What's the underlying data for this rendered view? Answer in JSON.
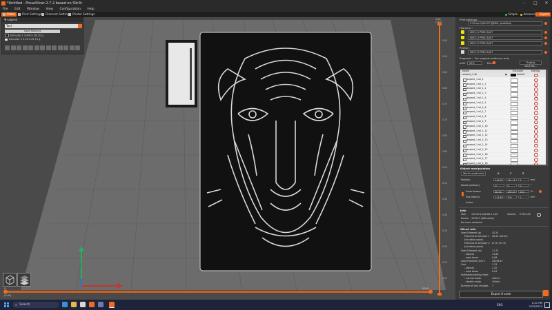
{
  "window": {
    "title": "*Untitled - PrusaSlicer-2.7.2 based on Slic3r",
    "controls": [
      "–",
      "□",
      "✕"
    ]
  },
  "menu": [
    "File",
    "Edit",
    "Window",
    "View",
    "Configuration",
    "Help"
  ],
  "tabs": [
    {
      "label": "Plater",
      "active": true
    },
    {
      "label": "Print Settings",
      "active": false
    },
    {
      "label": "Filament Settings",
      "active": false
    },
    {
      "label": "Printer Settings",
      "active": false
    }
  ],
  "modes": [
    {
      "label": "Simple",
      "color": "#2ecc40"
    },
    {
      "label": "Advanced",
      "color": "#f1c40f"
    },
    {
      "label": "Expert",
      "color": "#e74c3c"
    }
  ],
  "legend": {
    "title": "Legend",
    "view_type": "Tool",
    "section": "Used filament",
    "extruders": [
      {
        "label": "Extruder 1  9.49 m   28.52 g",
        "color": "#111111"
      },
      {
        "label": "Extruder 2  2.24 m   6.73 g",
        "color": "#e8e8e8"
      }
    ]
  },
  "view_cube_icons": [
    "cube-view-icon",
    "layers-view-icon"
  ],
  "slider": {
    "top_values": [
      "1.00",
      "(115)"
    ],
    "ticks": [
      "0.95",
      "0.90",
      "0.85",
      "0.80",
      "0.75",
      "0.70",
      "0.65",
      "0.60",
      "0.55",
      "0.50",
      "0.45",
      "0.40",
      "0.35",
      "0.30",
      "0.25",
      "0.20"
    ],
    "bottom_left": "0",
    "bottom_left2": "(0.00)",
    "bottom_right": "6188"
  },
  "sidebar": {
    "print_settings_label": "Print settings :",
    "print_profile": "0.20mm QUALITY @MK4 (modified)",
    "filament_label": "Filament :",
    "filaments": [
      {
        "name": "SKR 1.2 PREC A/UIT",
        "color": "#f2e600"
      },
      {
        "name": "SKR 1.2 PREC A/UIT",
        "color": "#f2e600"
      },
      {
        "name": "SKR 1.2 PREC A/UIT",
        "color": "#f2e600"
      }
    ],
    "printer_label": "Printer :",
    "printer": "SKR 1.2 PREC A/UIT",
    "supports_label": "Supports :",
    "supports_value": "For support enforcers only",
    "infill_label": "Infill :",
    "infill_value": "20%",
    "brim_label": "Brim :",
    "purging_button": "Purging volumes...",
    "list_headers": {
      "name": "Name",
      "extruder": "Extruder",
      "editing": "Editing"
    },
    "objects": [
      {
        "name": "Leopard_1.stl",
        "extruder": "default"
      },
      {
        "name": "Leopard_1.stl_1",
        "extruder": "1"
      },
      {
        "name": "Leopard_1.stl_1_1",
        "extruder": "1"
      },
      {
        "name": "Leopard_1.stl_1_2",
        "extruder": "1"
      },
      {
        "name": "Leopard_1.stl_1_3",
        "extruder": "1"
      },
      {
        "name": "Leopard_1.stl_1_4",
        "extruder": "1"
      },
      {
        "name": "Leopard_1.stl_1_5",
        "extruder": "1"
      },
      {
        "name": "Leopard_1.stl_1_6",
        "extruder": "1"
      },
      {
        "name": "Leopard_1.stl_1_7",
        "extruder": "1"
      },
      {
        "name": "Leopard_1.stl_1_8",
        "extruder": "1"
      },
      {
        "name": "Leopard_1.stl_1_9",
        "extruder": "1"
      },
      {
        "name": "Leopard_1.stl_1_10",
        "extruder": "1"
      },
      {
        "name": "Leopard_1.stl_1_11",
        "extruder": "1"
      },
      {
        "name": "Leopard_1.stl_1_12",
        "extruder": "1"
      },
      {
        "name": "Leopard_1.stl_1_13",
        "extruder": "1"
      },
      {
        "name": "Leopard_1.stl_1_14",
        "extruder": "1"
      },
      {
        "name": "Leopard_1.stl_1_15",
        "extruder": "1"
      },
      {
        "name": "Leopard_1.stl_1_16",
        "extruder": "1"
      },
      {
        "name": "Leopard_1.stl_1_17",
        "extruder": "1"
      },
      {
        "name": "Leopard_1.stl_1_18",
        "extruder": "1"
      },
      {
        "name": "Leopard_1.stl_1_19",
        "extruder": "1"
      },
      {
        "name": "Leopard_1.stl_1_20",
        "extruder": "1"
      },
      {
        "name": "Leopard_1.stl_1_21",
        "extruder": "1"
      }
    ],
    "object_manipulation": {
      "title": "Object manipulation",
      "coord_system": "World coordinates",
      "axes": [
        "X",
        "Y",
        "Z"
      ],
      "position_label": "Position:",
      "position": [
        "146.02",
        "114.18",
        "1"
      ],
      "rotation_label": "Rotate (relative):",
      "rotation": [
        "0",
        "0",
        "0"
      ],
      "scale_label": "Scale factors:",
      "scale": [
        "80.00",
        "149.25",
        "100"
      ],
      "size_label": "Size (World):",
      "size": [
        "119.63",
        "200",
        "2"
      ],
      "unit_mm": "mm",
      "unit_deg": "°",
      "unit_pct": "%",
      "inches": "Inches"
    },
    "info": {
      "title": "Info",
      "size_label": "Size:",
      "size": "119.63 x 200.00 x 2.00",
      "volume_label": "Volume:",
      "volume": "27524.09",
      "facets_label": "Facets:",
      "facets": "155112 (460 shells)",
      "errors": "No errors detected"
    },
    "sliced_info": {
      "title": "Sliced Info",
      "rows": [
        {
          "k": "Used Filament (g)",
          "v": "35.24"
        },
        {
          "k": "Filament at extruder 1",
          "v": "28.52 (28.52)"
        },
        {
          "k": "(including spool)",
          "v": ""
        },
        {
          "k": "Filament at extruder 2",
          "v": "6.73 (71.73)"
        },
        {
          "k": "(including spool)",
          "v": ""
        },
        {
          "k": "Used Filament (m)",
          "v": "11.72"
        },
        {
          "k": "- objects",
          "v": "11.64"
        },
        {
          "k": "- wipe tower",
          "v": "0.08"
        },
        {
          "k": "Used Filament (mm³)",
          "v": "28196.47"
        },
        {
          "k": "Cost",
          "v": "1.23"
        },
        {
          "k": "- objects",
          "v": "1.20"
        },
        {
          "k": "- wipe tower",
          "v": "0.03"
        },
        {
          "k": "Estimated printing time:",
          "v": ""
        },
        {
          "k": "- normal mode",
          "v": "1h43m"
        },
        {
          "k": "- stealth mode",
          "v": "1h50m"
        },
        {
          "k": "Number of tool changes",
          "v": "1"
        }
      ]
    },
    "export_button": "Export G-code"
  },
  "taskbar": {
    "search_placeholder": "Search",
    "time": "2:41 PM",
    "date": "7/03/2024",
    "lang": "ENG"
  }
}
